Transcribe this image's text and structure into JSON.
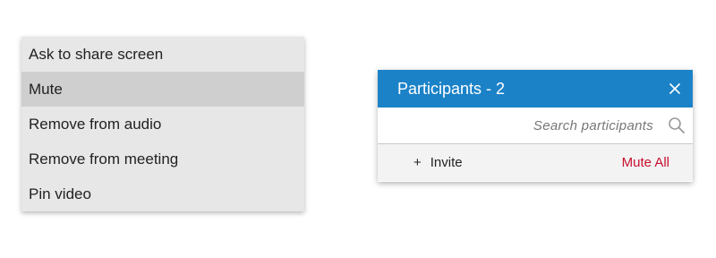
{
  "context_menu": {
    "items": [
      {
        "label": "Ask to share screen"
      },
      {
        "label": "Mute"
      },
      {
        "label": "Remove from audio"
      },
      {
        "label": "Remove from meeting"
      },
      {
        "label": "Pin video"
      }
    ],
    "highlighted_item": "Mute"
  },
  "participants_panel": {
    "title": "Participants - 2",
    "header_color": "#1b82c8",
    "close_icon": "close-icon",
    "search": {
      "placeholder": "Search participants",
      "value": "",
      "icon": "search-icon"
    },
    "actions": {
      "invite_icon": "plus-icon",
      "invite_label": "Invite",
      "mute_all_label": "Mute All",
      "mute_all_color": "#c8102e"
    }
  }
}
